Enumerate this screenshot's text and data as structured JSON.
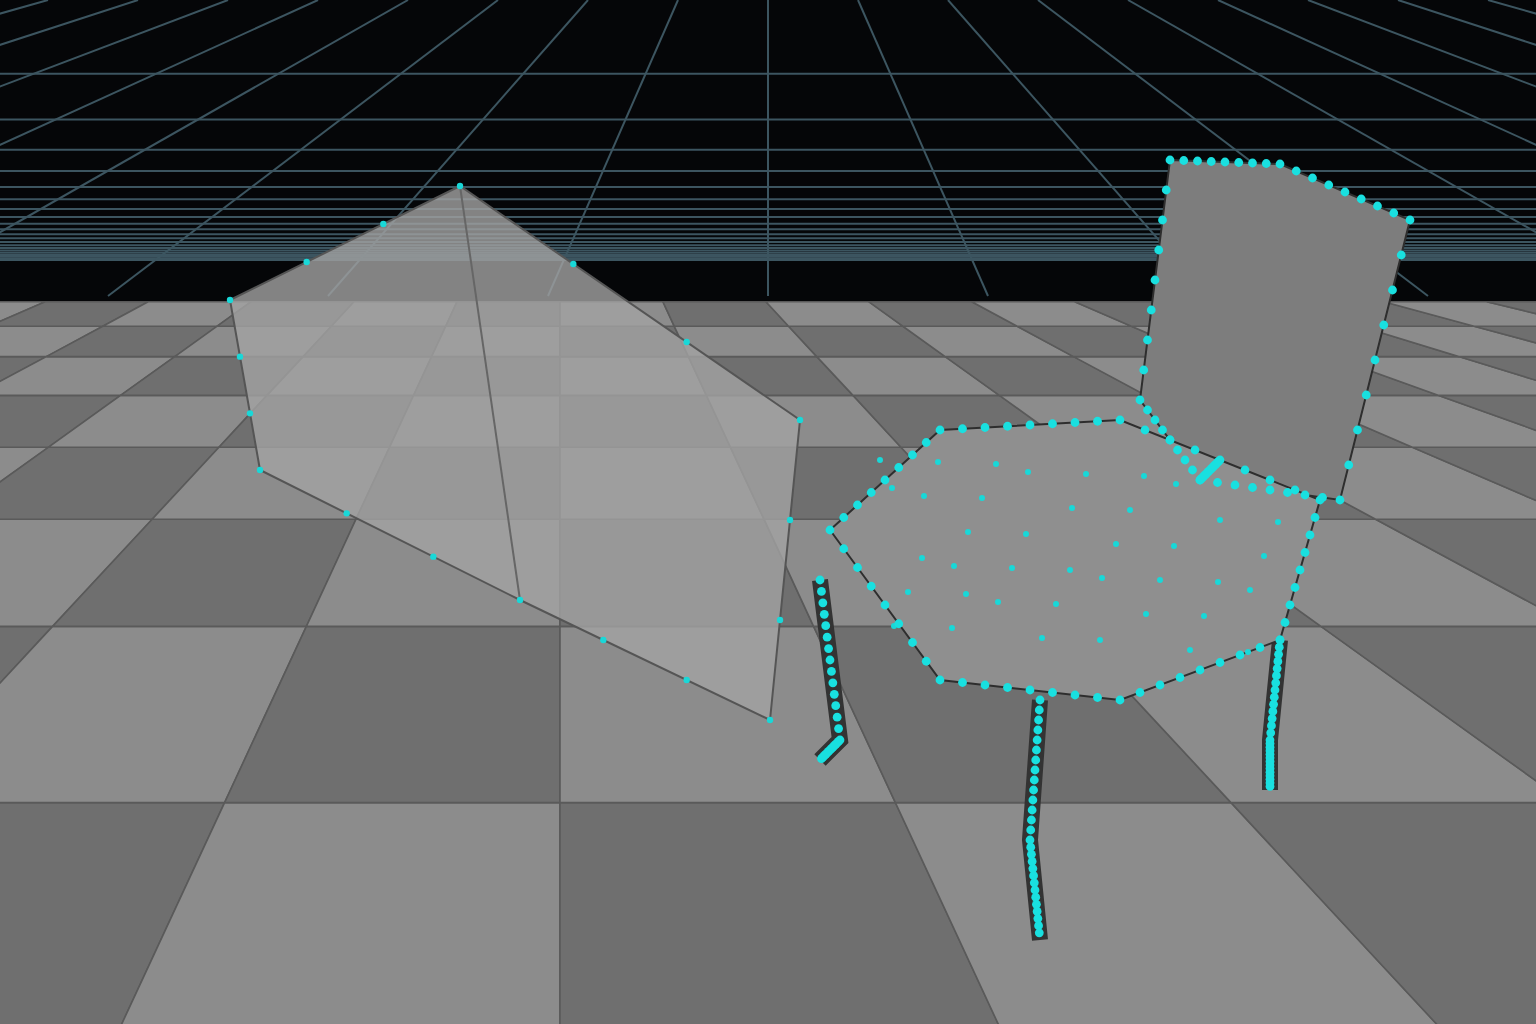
{
  "viewport": {
    "kind": "wireframe-scene"
  }
}
